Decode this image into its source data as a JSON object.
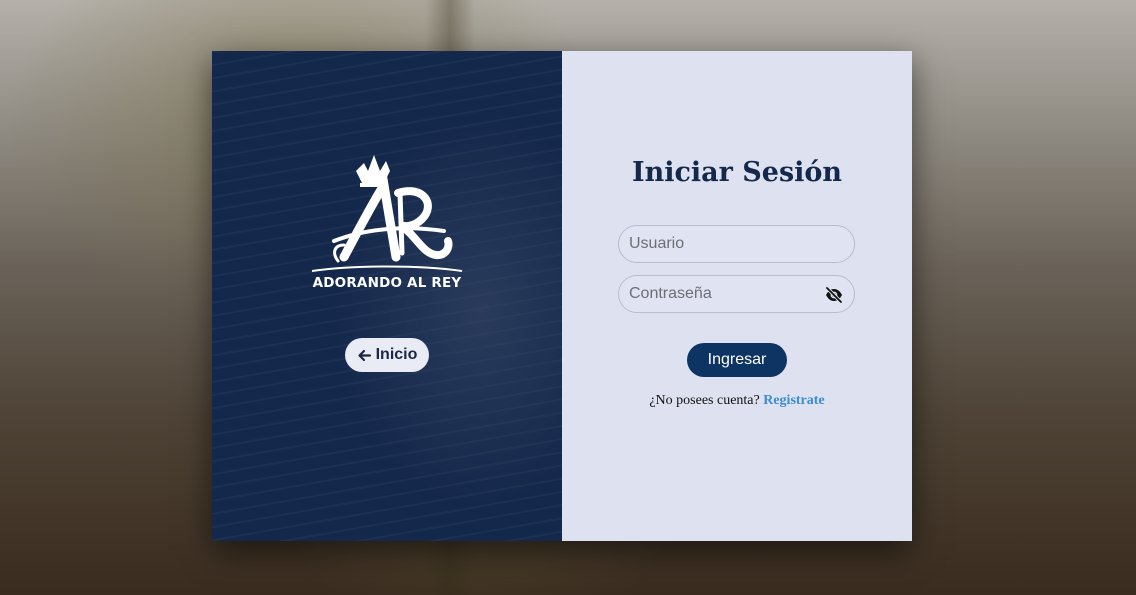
{
  "brand": {
    "name": "ADORANDO AL REY",
    "monogram": "AR"
  },
  "left_panel": {
    "home_button_label": "Inicio",
    "home_icon": "arrow-left-icon"
  },
  "login": {
    "title": "Iniciar Sesión",
    "username_placeholder": "Usuario",
    "username_value": "",
    "password_placeholder": "Contraseña",
    "password_value": "",
    "password_toggle_icon": "eye-slash-icon",
    "submit_label": "Ingresar",
    "register_prompt": "¿No posees cuenta?",
    "register_link": "Registrate"
  },
  "colors": {
    "left_panel_bg": "#14284b",
    "right_panel_bg": "#dde1f0",
    "primary_button": "#0e3464",
    "link": "#3c8cd0",
    "title": "#14284b"
  }
}
